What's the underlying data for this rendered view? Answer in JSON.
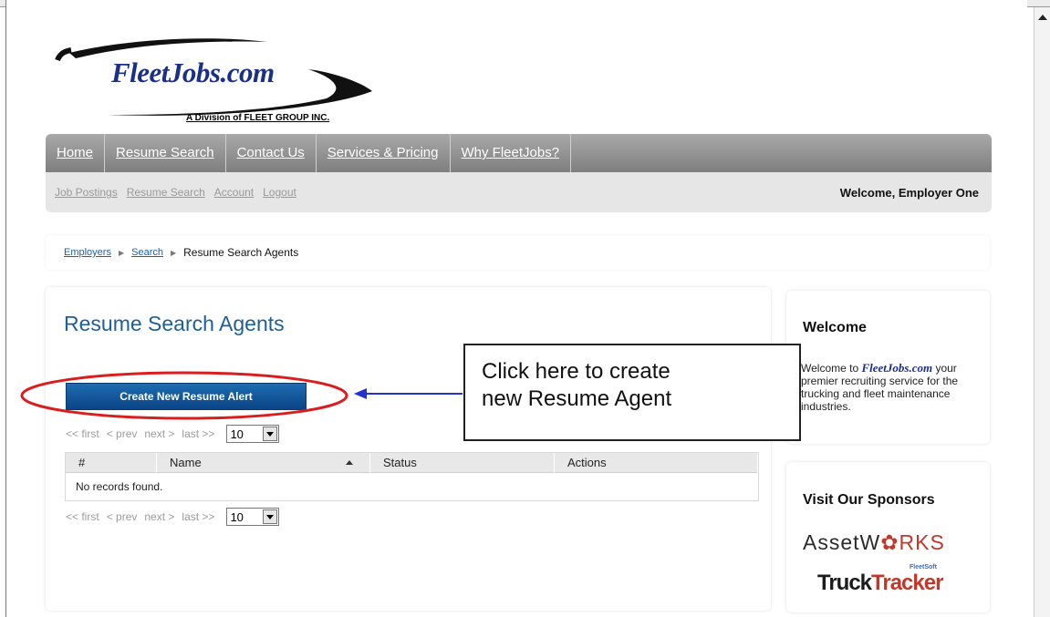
{
  "logo": {
    "title": "FleetJobs.com",
    "subtitle": "A Division of FLEET GROUP INC."
  },
  "main_nav": {
    "items": [
      "Home",
      "Resume Search",
      "Contact Us",
      "Services & Pricing",
      "Why FleetJobs?"
    ]
  },
  "sub_nav": {
    "links": [
      "Job Postings",
      "Resume Search",
      "Account",
      "Logout"
    ],
    "welcome": "Welcome, Employer One"
  },
  "breadcrumb": {
    "items": [
      "Employers",
      "Search"
    ],
    "current": "Resume Search Agents"
  },
  "main": {
    "title": "Resume Search Agents",
    "create_button": "Create New Resume Alert",
    "pager": {
      "first": "<< first",
      "prev": "< prev",
      "next": "next >",
      "last": "last >>",
      "page_size": "10"
    },
    "table": {
      "headers": [
        "#",
        "Name",
        "Status",
        "Actions"
      ],
      "empty_message": "No records found."
    }
  },
  "callout": {
    "line1": "Click here to create",
    "line2": "new Resume Agent"
  },
  "sidebar": {
    "welcome": {
      "title": "Welcome",
      "prefix": "Welcome to ",
      "brand": "FleetJobs.com",
      "body": "your premier recruiting service for the trucking and fleet maintenance industries."
    },
    "sponsors": {
      "title": "Visit Our Sponsors",
      "asset_part1": "AssetW",
      "asset_symbol": "✿",
      "asset_part2": "RKS",
      "truck_part1": "Truck",
      "truck_part2": "Tracker",
      "truck_tag": "FleetSoft"
    }
  },
  "colors": {
    "brand_blue": "#1a2f86",
    "button_blue": "#0b4487",
    "annotation_red": "#d91e1e",
    "annotation_arrow": "#2233cc"
  }
}
